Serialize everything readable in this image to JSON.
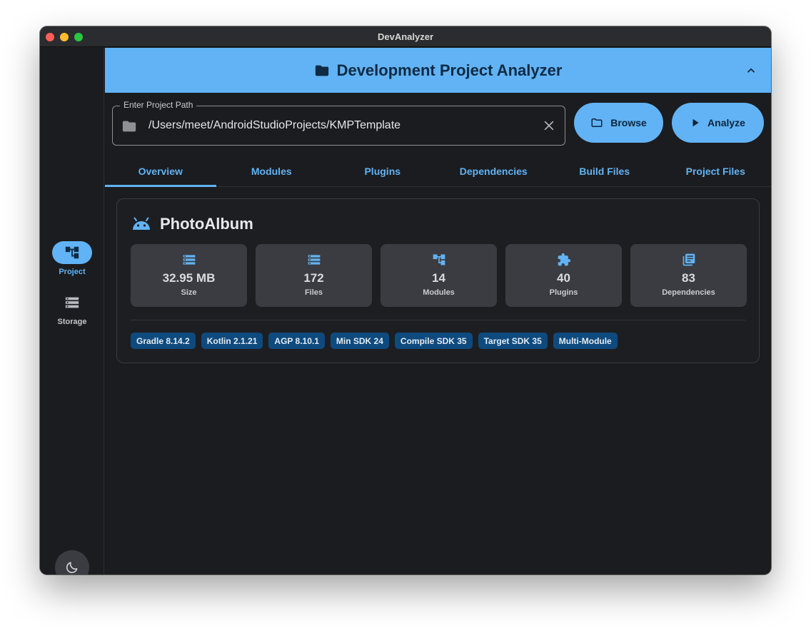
{
  "window": {
    "title": "DevAnalyzer"
  },
  "sidebar": {
    "items": [
      {
        "label": "Project",
        "icon": "project-tree-icon",
        "active": true
      },
      {
        "label": "Storage",
        "icon": "storage-icon",
        "active": false
      }
    ],
    "theme_toggle": {
      "icon": "moon-icon"
    }
  },
  "header": {
    "title": "Development Project Analyzer",
    "icon": "folder-icon",
    "collapse_icon": "chevron-up-icon"
  },
  "path_field": {
    "legend": "Enter Project Path",
    "value": "/Users/meet/AndroidStudioProjects/KMPTemplate"
  },
  "buttons": {
    "browse": "Browse",
    "analyze": "Analyze"
  },
  "tabs": [
    "Overview",
    "Modules",
    "Plugins",
    "Dependencies",
    "Build Files",
    "Project Files"
  ],
  "active_tab": "Overview",
  "project": {
    "name": "PhotoAlbum",
    "icon": "android-icon",
    "stats": [
      {
        "value": "32.95 MB",
        "label": "Size",
        "icon": "storage-icon"
      },
      {
        "value": "172",
        "label": "Files",
        "icon": "storage-icon"
      },
      {
        "value": "14",
        "label": "Modules",
        "icon": "project-tree-icon"
      },
      {
        "value": "40",
        "label": "Plugins",
        "icon": "puzzle-icon"
      },
      {
        "value": "83",
        "label": "Dependencies",
        "icon": "library-icon"
      }
    ],
    "badges": [
      "Gradle 8.14.2",
      "Kotlin 2.1.21",
      "AGP 8.10.1",
      "Min SDK 24",
      "Compile SDK 35",
      "Target SDK 35",
      "Multi-Module"
    ]
  },
  "colors": {
    "accent": "#61b3f5",
    "background": "#1b1c1f",
    "card": "#3a3c41",
    "badge": "#0e4a7d"
  }
}
